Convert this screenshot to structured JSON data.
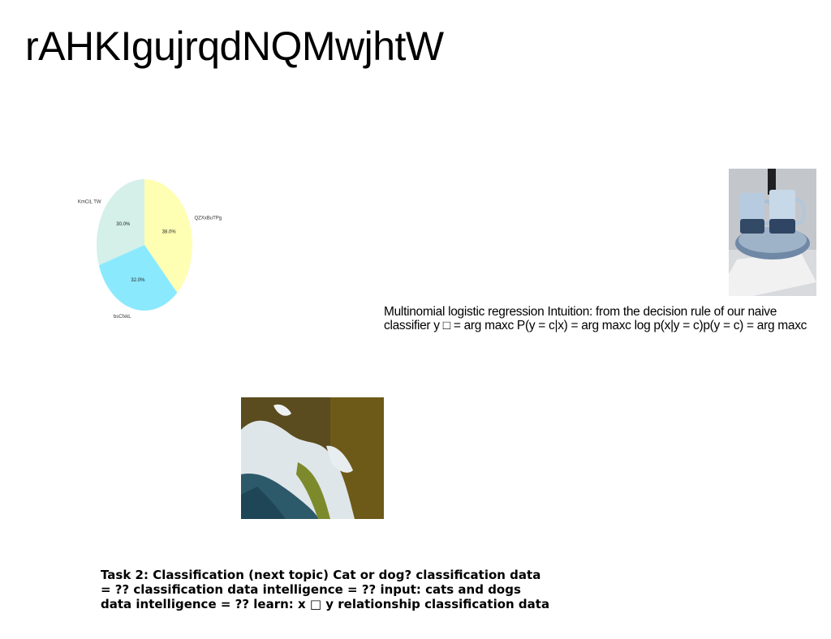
{
  "slide": {
    "title": "rAHKIgujrqdNQMwjhtW",
    "body_text": "Multinomial logistic regression Intuition: from the decision rule of our naive\nclassifier y □ = arg maxc P(y = c|x) = arg maxc log p(x|y = c)p(y = c) = arg maxc",
    "task_text": "Task 2: Classification (next topic) Cat or dog? classification data\n= ?? classification data intelligence = ?? input: cats and dogs\ndata intelligence = ?? learn: x □ y relationship classification data"
  },
  "chart_data": {
    "type": "pie",
    "categories": [
      "QZXxBuTPg",
      "bsCfxkL",
      "KmCiL TW"
    ],
    "values": [
      38.0,
      32.0,
      30.0
    ],
    "value_labels": [
      "38.0%",
      "32.0%",
      "30.0%"
    ],
    "colors": [
      "#ffffb3",
      "#8be9fd",
      "#d4f0e8"
    ],
    "title": "",
    "start_angle_deg": 90,
    "direction": "clockwise"
  },
  "images": {
    "mugs_photo": "ceramic mugs on tray",
    "landscape_photo": "aerial coastline"
  }
}
